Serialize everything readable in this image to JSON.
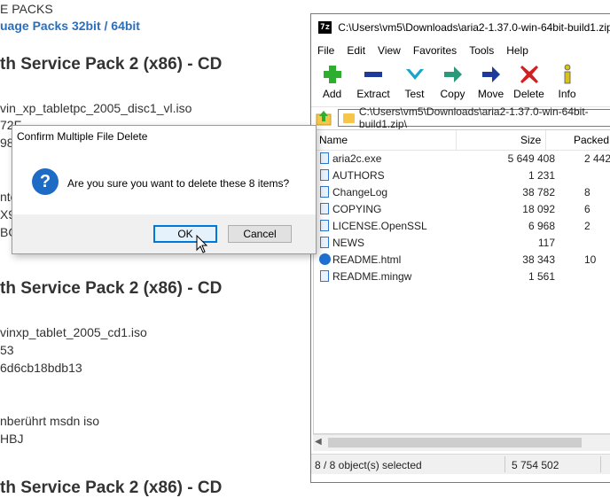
{
  "background_page": {
    "line1": "E PACKS",
    "link1": "uage Packs 32bit / 64bit",
    "heading1": "th Service Pack 2 (x86) - CD",
    "file1": "vin_xp_tabletpc_2005_disc1_vl.iso",
    "frag1": "72F",
    "frag2": "98",
    "frag3": "nto",
    "frag4": "X9",
    "frag5": "BG",
    "heading2": "th Service Pack 2 (x86) - CD",
    "file2": "vinxp_tablet_2005_cd1.iso",
    "frag6": "53",
    "frag7": "6d6cb18bdb13",
    "note": "nberührt msdn iso",
    "frag8": "HBJ",
    "heading3": "th Service Pack 2 (x86) - CD"
  },
  "zip_window": {
    "title": "C:\\Users\\vm5\\Downloads\\aria2-1.37.0-win-64bit-build1.zip\\",
    "app_icon_text": "7z",
    "menu": [
      "File",
      "Edit",
      "View",
      "Favorites",
      "Tools",
      "Help"
    ],
    "toolbar": [
      {
        "label": "Add",
        "icon": "plus-icon",
        "color": "#2eae2e"
      },
      {
        "label": "Extract",
        "icon": "minus-icon",
        "color": "#1f3a9c"
      },
      {
        "label": "Test",
        "icon": "check-icon",
        "color": "#1aa6c9"
      },
      {
        "label": "Copy",
        "icon": "copy-arrow-icon",
        "color": "#2a9a7a"
      },
      {
        "label": "Move",
        "icon": "move-arrow-icon",
        "color": "#1f3a9c"
      },
      {
        "label": "Delete",
        "icon": "delete-x-icon",
        "color": "#d21f1f"
      },
      {
        "label": "Info",
        "icon": "info-icon",
        "color": "#d8c21a"
      }
    ],
    "address": "C:\\Users\\vm5\\Downloads\\aria2-1.37.0-win-64bit-build1.zip\\",
    "columns": {
      "name": "Name",
      "size": "Size",
      "packed": "Packed"
    },
    "files": [
      {
        "name": "aria2c.exe",
        "size": "5 649 408",
        "packed": "2 442",
        "type": "file"
      },
      {
        "name": "AUTHORS",
        "size": "1 231",
        "packed": "",
        "type": "file"
      },
      {
        "name": "ChangeLog",
        "size": "38 782",
        "packed": "8",
        "type": "file"
      },
      {
        "name": "COPYING",
        "size": "18 092",
        "packed": "6",
        "type": "file"
      },
      {
        "name": "LICENSE.OpenSSL",
        "size": "6 968",
        "packed": "2",
        "type": "file"
      },
      {
        "name": "NEWS",
        "size": "117",
        "packed": "",
        "type": "file"
      },
      {
        "name": "README.html",
        "size": "38 343",
        "packed": "10",
        "type": "html"
      },
      {
        "name": "README.mingw",
        "size": "1 561",
        "packed": "",
        "type": "file"
      }
    ],
    "status": {
      "selection": "8 / 8 object(s) selected",
      "size": "5 754 502"
    }
  },
  "dialog": {
    "title": "Confirm Multiple File Delete",
    "message": "Are you sure you want to delete these 8 items?",
    "ok_label": "OK",
    "cancel_label": "Cancel"
  }
}
